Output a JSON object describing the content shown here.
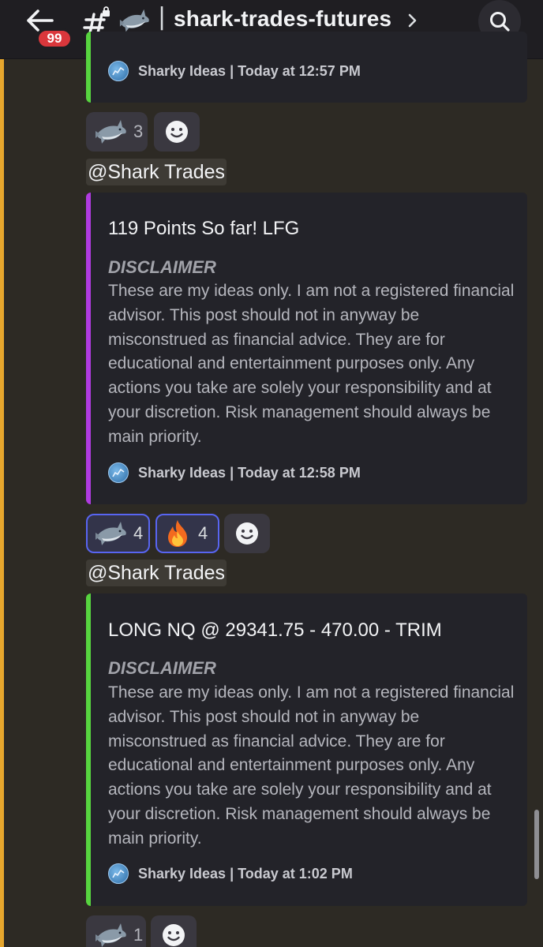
{
  "header": {
    "unread_badge": "99",
    "divider": "|",
    "channel_name": "shark-trades-futures",
    "channel_emoji": "shark"
  },
  "messages": [
    {
      "footer": "Sharky Ideas | Today at 12:57 PM",
      "reactions": [
        {
          "emoji": "shark",
          "count": "3",
          "active": false
        }
      ]
    },
    {
      "mention": "@Shark Trades",
      "title": "119 Points So far! LFG",
      "disclaimer_heading": "DISCLAIMER",
      "disclaimer_body": "These are my ideas only. I am not a registered financial advisor. This post should not in anyway be misconstrued as financial advice. They are for educational and entertainment purposes only. Any actions you take are solely your responsibility and at your discretion. Risk management should always be main priority.",
      "footer": "Sharky Ideas | Today at 12:58 PM",
      "accent": "#b03be0",
      "reactions": [
        {
          "emoji": "shark",
          "count": "4",
          "active": true
        },
        {
          "emoji": "fire",
          "count": "4",
          "active": true
        }
      ]
    },
    {
      "mention": "@Shark Trades",
      "title": "LONG NQ @ 29341.75 - 470.00 - TRIM",
      "disclaimer_heading": "DISCLAIMER",
      "disclaimer_body": "These are my ideas only. I am not a registered financial advisor. This post should not in anyway be misconstrued as financial advice. They are for educational and entertainment purposes only. Any actions you take are solely your responsibility and at your discretion. Risk management should always be main priority.",
      "footer": "Sharky Ideas | Today at 1:02 PM",
      "accent": "#57d43f",
      "reactions": [
        {
          "emoji": "shark",
          "count": "1",
          "active": false
        }
      ]
    }
  ],
  "colors": {
    "background": "#2d2a24",
    "embed_background": "#232329",
    "mention_bar": "#e6a62d",
    "active_reaction_border": "#5865f2",
    "badge": "#da373c"
  }
}
